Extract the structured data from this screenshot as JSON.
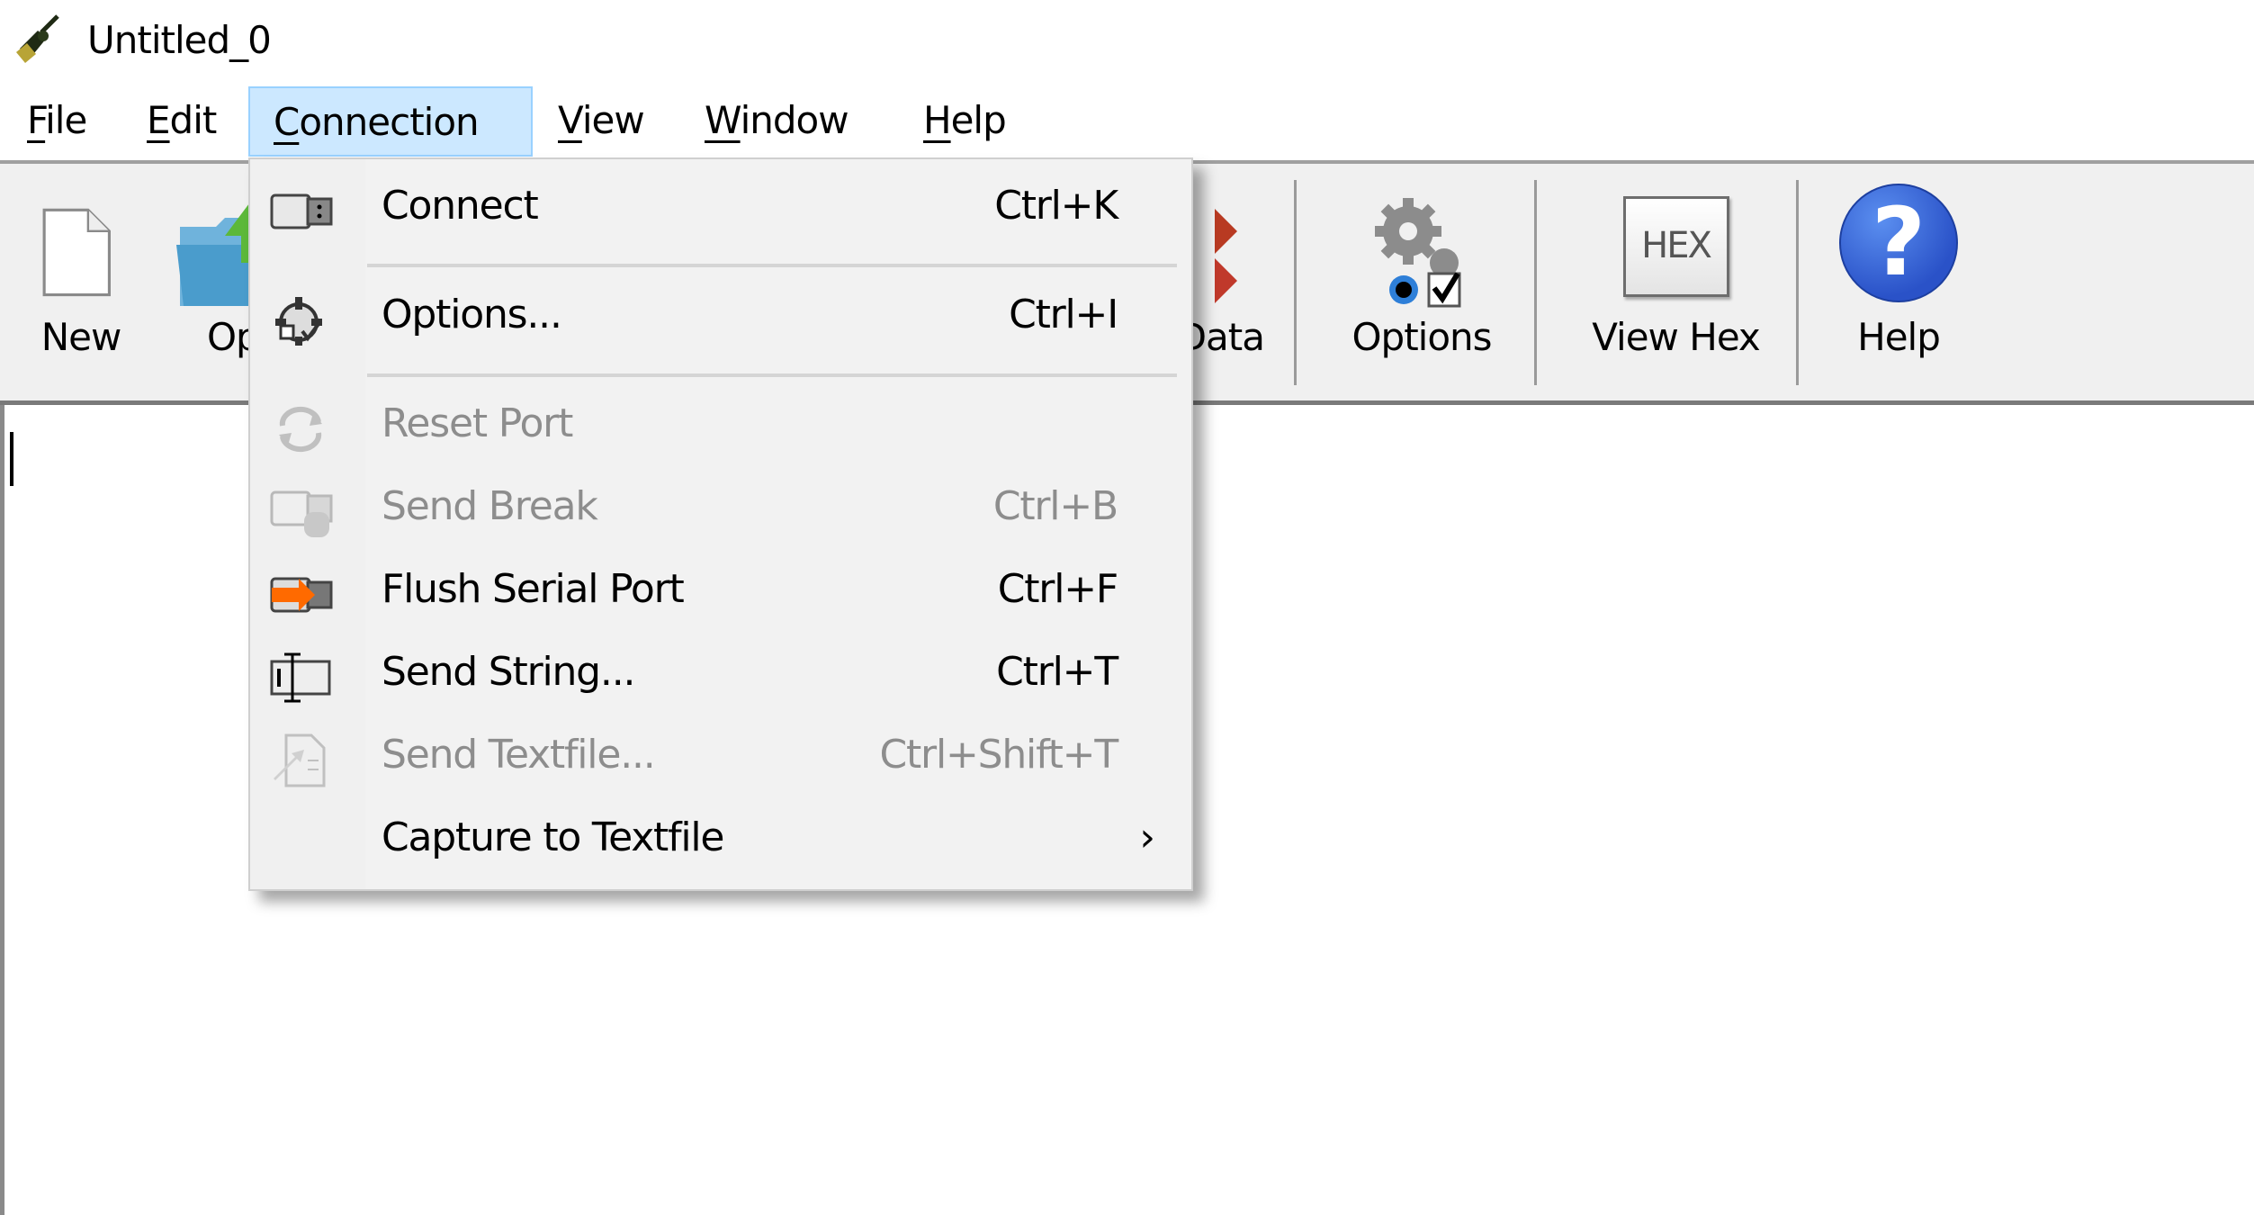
{
  "window": {
    "title": "Untitled_0",
    "app_icon": "serial-plug-icon"
  },
  "menubar": {
    "items": [
      {
        "label": "File",
        "mnemonic": "F",
        "rest": "ile"
      },
      {
        "label": "Edit",
        "mnemonic": "E",
        "rest": "dit"
      },
      {
        "label": "Connection",
        "mnemonic": "C",
        "rest": "onnection",
        "active": true
      },
      {
        "label": "View",
        "mnemonic": "V",
        "rest": "iew"
      },
      {
        "label": "Window",
        "mnemonic": "W",
        "rest": "indow"
      },
      {
        "label": "Help",
        "mnemonic": "H",
        "rest": "elp"
      }
    ]
  },
  "toolbar": {
    "items": [
      {
        "label": "New",
        "icon": "new-document-icon"
      },
      {
        "label": "Op",
        "icon": "open-folder-icon"
      },
      {
        "label": "Data",
        "icon": "send-data-icon"
      },
      {
        "label": "Options",
        "icon": "options-gears-icon"
      },
      {
        "label": "View Hex",
        "icon": "hex-icon",
        "icon_text": "HEX"
      },
      {
        "label": "Help",
        "icon": "help-icon",
        "icon_text": "?"
      }
    ]
  },
  "connection_menu": {
    "items": [
      {
        "label": "Connect",
        "shortcut": "Ctrl+K",
        "icon": "usb-plug-icon",
        "enabled": true
      },
      {
        "separator": true
      },
      {
        "label": "Options...",
        "shortcut": "Ctrl+I",
        "icon": "gear-options-icon",
        "enabled": true
      },
      {
        "separator": true
      },
      {
        "label": "Reset Port",
        "shortcut": "",
        "icon": "refresh-icon",
        "enabled": false
      },
      {
        "label": "Send Break",
        "shortcut": "Ctrl+B",
        "icon": "send-break-icon",
        "enabled": false
      },
      {
        "label": "Flush Serial Port",
        "shortcut": "Ctrl+F",
        "icon": "flush-port-icon",
        "enabled": true
      },
      {
        "label": "Send String...",
        "shortcut": "Ctrl+T",
        "icon": "send-string-icon",
        "enabled": true
      },
      {
        "label": "Send Textfile...",
        "shortcut": "Ctrl+Shift+T",
        "icon": "send-textfile-icon",
        "enabled": false
      },
      {
        "label": "Capture to Textfile",
        "shortcut": "",
        "icon": "",
        "enabled": true,
        "submenu": true,
        "submenu_arrow": "›"
      }
    ]
  },
  "editor": {
    "content": ""
  },
  "colors": {
    "menu_highlight": "#cce8ff",
    "menu_highlight_border": "#99d1ff",
    "toolbar_bg": "#f0f0f0",
    "menu_bg": "#f2f2f2",
    "disabled_text": "#8d8d8d",
    "help_blue": "#2f5fd0",
    "flush_orange": "#ff6a00"
  }
}
